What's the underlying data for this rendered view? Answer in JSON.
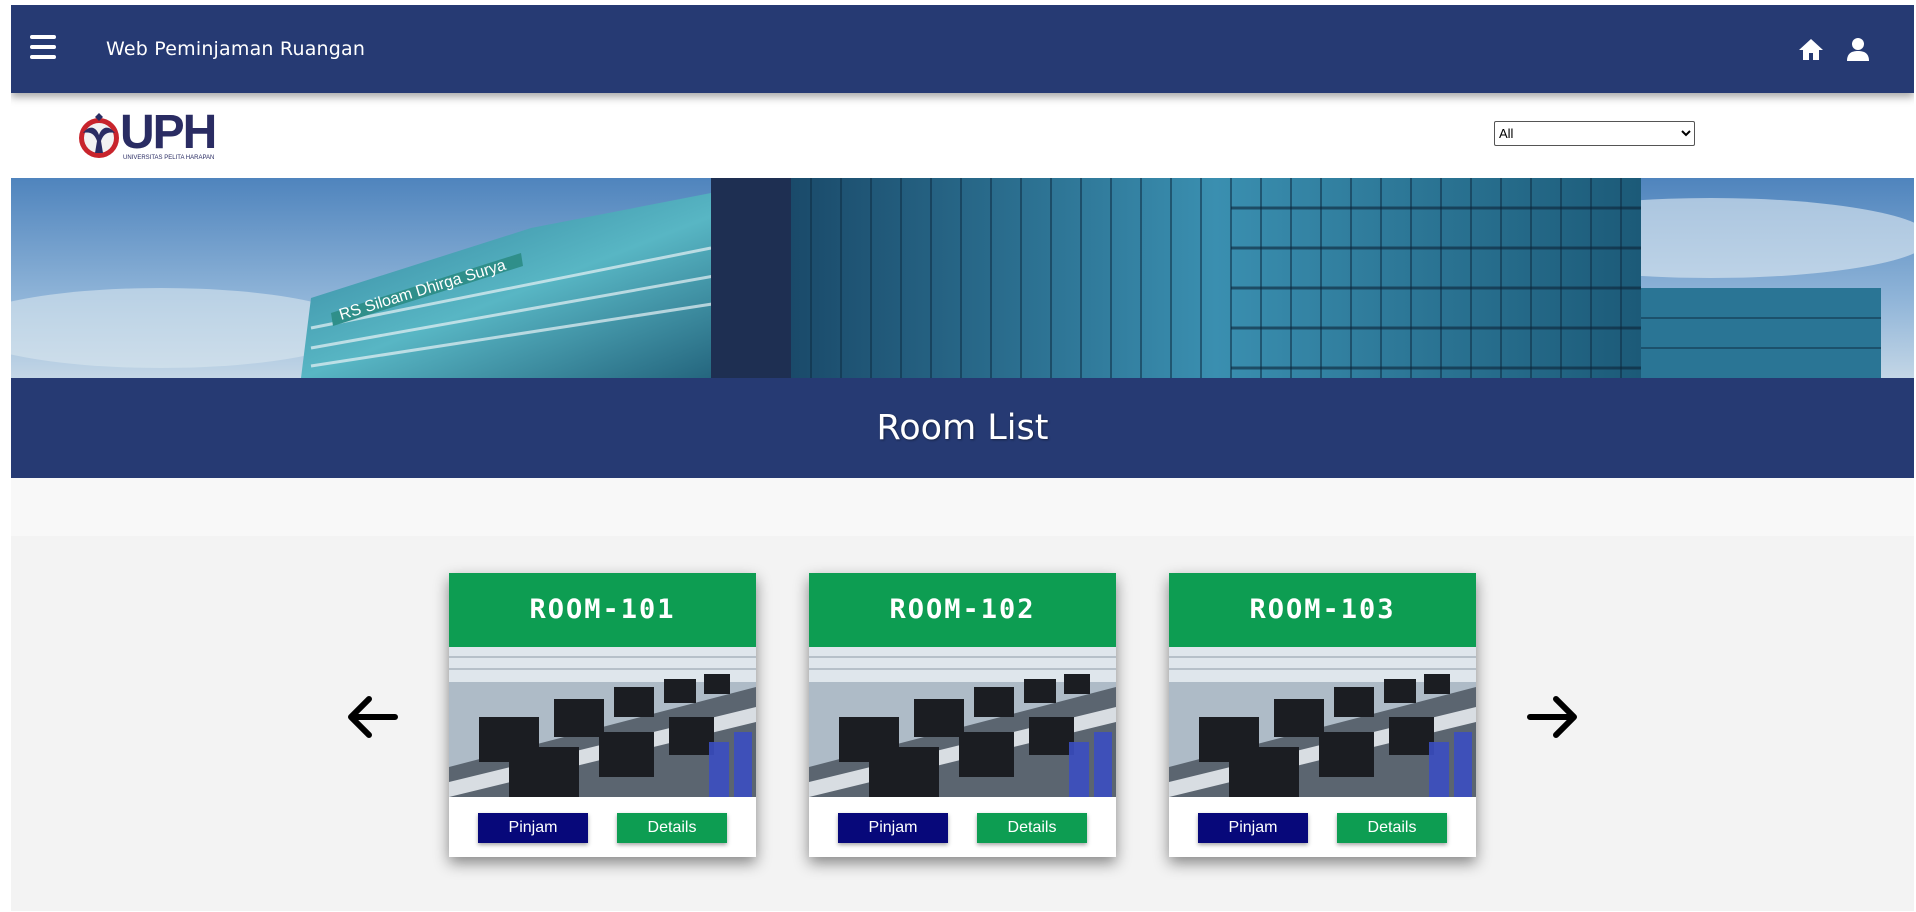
{
  "navbar": {
    "title": "Web Peminjaman Ruangan",
    "menu_icon": "hamburger-menu-icon",
    "home_icon": "home-icon",
    "user_icon": "user-icon",
    "color": "#263a73"
  },
  "logo": {
    "text": "UPH",
    "subtitle": "UNIVERSITAS PELITA HARAPAN"
  },
  "filter": {
    "selected": "All",
    "options": [
      "All"
    ]
  },
  "page": {
    "title": "Room List"
  },
  "carousel": {
    "prev_icon": "arrow-left-icon",
    "next_icon": "arrow-right-icon",
    "rooms": [
      {
        "name": "ROOM-101",
        "pinjam_label": "Pinjam",
        "details_label": "Details"
      },
      {
        "name": "ROOM-102",
        "pinjam_label": "Pinjam",
        "details_label": "Details"
      },
      {
        "name": "ROOM-103",
        "pinjam_label": "Pinjam",
        "details_label": "Details"
      }
    ]
  },
  "colors": {
    "primary": "#263a73",
    "accent_green": "#0d9d52",
    "button_navy": "#07087a"
  }
}
